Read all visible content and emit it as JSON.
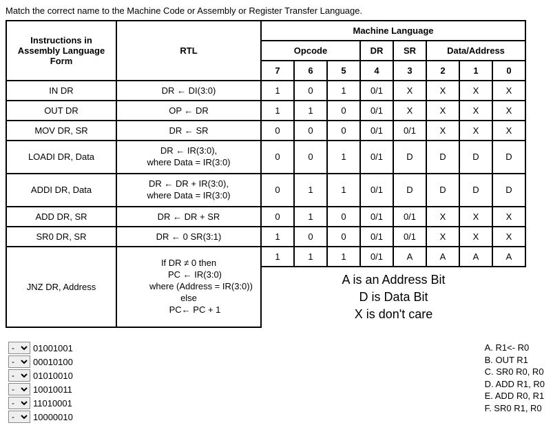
{
  "prompt": "Match the correct name to the Machine Code or Assembly or Register Transfer Language.",
  "headers": {
    "instructions": "Instructions in Assembly Language Form",
    "rtl": "RTL",
    "machine_language": "Machine Language",
    "opcode": "Opcode",
    "dr": "DR",
    "sr": "SR",
    "data_address": "Data/Address",
    "b7": "7",
    "b6": "6",
    "b5": "5",
    "b4": "4",
    "b3": "3",
    "b2": "2",
    "b1": "1",
    "b0": "0"
  },
  "rows": [
    {
      "instr": "IN  DR",
      "rtl": "DR ← DI(3:0)",
      "bits": [
        "1",
        "0",
        "1",
        "0/1",
        "X",
        "X",
        "X",
        "X"
      ]
    },
    {
      "instr": "OUT  DR",
      "rtl": "OP ← DR",
      "bits": [
        "1",
        "1",
        "0",
        "0/1",
        "X",
        "X",
        "X",
        "X"
      ]
    },
    {
      "instr": "MOV DR, SR",
      "rtl": "DR ← SR",
      "bits": [
        "0",
        "0",
        "0",
        "0/1",
        "0/1",
        "X",
        "X",
        "X"
      ]
    },
    {
      "instr": "LOADI DR, Data",
      "rtl_lines": [
        "DR ← IR(3:0),",
        "where Data = IR(3:0)"
      ],
      "bits": [
        "0",
        "0",
        "1",
        "0/1",
        "D",
        "D",
        "D",
        "D"
      ]
    },
    {
      "instr": "ADDI DR, Data",
      "rtl_lines": [
        "DR ← DR + IR(3:0),",
        "where Data = IR(3:0)"
      ],
      "bits": [
        "0",
        "1",
        "1",
        "0/1",
        "D",
        "D",
        "D",
        "D"
      ]
    },
    {
      "instr": "ADD DR, SR",
      "rtl": "DR ← DR + SR",
      "bits": [
        "0",
        "1",
        "0",
        "0/1",
        "0/1",
        "X",
        "X",
        "X"
      ]
    },
    {
      "instr": "SR0 DR, SR",
      "rtl": "DR ← 0 SR(3:1)",
      "bits": [
        "1",
        "0",
        "0",
        "0/1",
        "0/1",
        "X",
        "X",
        "X"
      ]
    }
  ],
  "jnz": {
    "instr": "JNZ DR, Address",
    "rtl_l1": "If DR ≠ 0 then",
    "rtl_l2": "PC ← IR(3:0)",
    "rtl_l3": "where (Address = IR(3:0))",
    "rtl_l4": "else",
    "rtl_l5": "PC← PC + 1",
    "bits": [
      "1",
      "1",
      "1",
      "0/1",
      "A",
      "A",
      "A",
      "A"
    ]
  },
  "legend": {
    "a": "A   is an Address Bit",
    "d": "D   is Data Bit",
    "x": "X   is don't care"
  },
  "questions": [
    {
      "code": "01001001"
    },
    {
      "code": "00010100"
    },
    {
      "code": "01010010"
    },
    {
      "code": "10010011"
    },
    {
      "code": "11010001"
    },
    {
      "code": "10000010"
    }
  ],
  "answers": [
    "A. R1<- R0",
    "B. OUT R1",
    "C. SR0 R0, R0",
    "D. ADD R1, R0",
    "E. ADD R0, R1",
    "F. SR0 R1, R0"
  ],
  "select_placeholder": "-"
}
